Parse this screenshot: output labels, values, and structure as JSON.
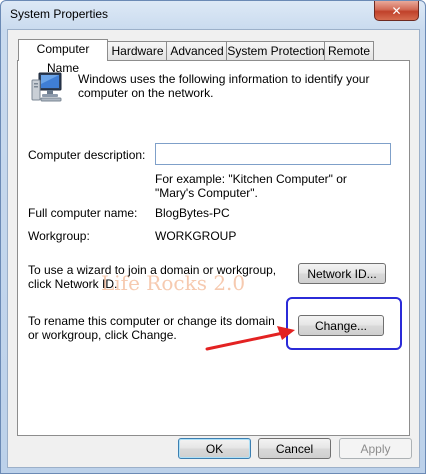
{
  "window": {
    "title": "System Properties",
    "close_glyph": "✕"
  },
  "tabs": [
    {
      "label": "Computer Name",
      "active": true
    },
    {
      "label": "Hardware",
      "active": false
    },
    {
      "label": "Advanced",
      "active": false
    },
    {
      "label": "System Protection",
      "active": false
    },
    {
      "label": "Remote",
      "active": false
    }
  ],
  "computer_name": {
    "icon": "computer-monitor-icon",
    "intro": "Windows uses the following information to identify your computer on the network.",
    "description_label": "Computer description:",
    "description_value": "",
    "example": "For example: \"Kitchen Computer\" or \"Mary's Computer\".",
    "full_name_label": "Full computer name:",
    "full_name_value": "BlogBytes-PC",
    "workgroup_label": "Workgroup:",
    "workgroup_value": "WORKGROUP",
    "network_text": "To use a wizard to join a domain or workgroup, click Network ID.",
    "network_button": "Network ID...",
    "rename_text": "To rename this computer or change its domain or workgroup, click Change.",
    "change_button": "Change..."
  },
  "watermark": "Life Rocks 2.0",
  "footer": {
    "ok": "OK",
    "cancel": "Cancel",
    "apply": "Apply"
  },
  "colors": {
    "highlight": "#2b2bd8",
    "arrow": "#e32222"
  }
}
